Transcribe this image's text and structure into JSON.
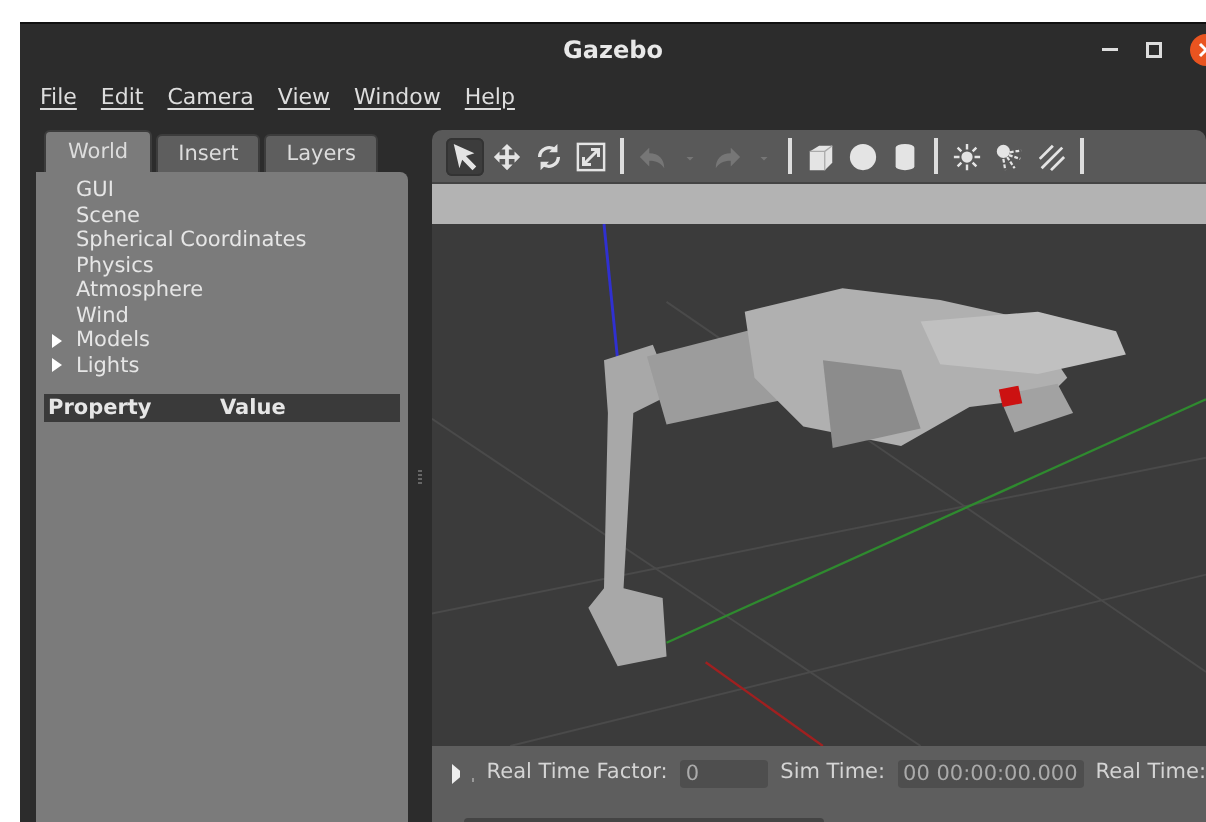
{
  "window": {
    "title": "Gazebo",
    "controls": [
      {
        "kind": "minimize"
      },
      {
        "kind": "maximize"
      },
      {
        "kind": "close"
      }
    ]
  },
  "menu": [
    "File",
    "Edit",
    "Camera",
    "View",
    "Window",
    "Help"
  ],
  "tabs": [
    {
      "label": "World",
      "selected": true
    },
    {
      "label": "Insert",
      "selected": false
    },
    {
      "label": "Layers",
      "selected": false
    }
  ],
  "tree": [
    {
      "label": "GUI",
      "kind": "leaf"
    },
    {
      "label": "Scene",
      "kind": "leaf"
    },
    {
      "label": "Spherical Coordinates",
      "kind": "leaf"
    },
    {
      "label": "Physics",
      "kind": "leaf"
    },
    {
      "label": "Atmosphere",
      "kind": "leaf"
    },
    {
      "label": "Wind",
      "kind": "leaf"
    },
    {
      "label": "Models",
      "kind": "group",
      "expanded": false
    },
    {
      "label": "Lights",
      "kind": "group",
      "expanded": false
    }
  ],
  "properties": {
    "columns": [
      "Property",
      "Value"
    ]
  },
  "toolbar": [
    {
      "tools": [
        {
          "kind": "select",
          "selected": true,
          "disabled": false
        },
        {
          "kind": "translate",
          "selected": false,
          "disabled": false
        },
        {
          "kind": "rotate",
          "selected": false,
          "disabled": false
        },
        {
          "kind": "scale",
          "selected": false,
          "disabled": false
        }
      ]
    },
    {
      "tools": [
        {
          "kind": "undo",
          "selected": false,
          "disabled": true
        },
        {
          "kind": "caret",
          "selected": false,
          "disabled": true
        },
        {
          "kind": "redo",
          "selected": false,
          "disabled": true
        },
        {
          "kind": "caret",
          "selected": false,
          "disabled": true
        }
      ]
    },
    {
      "tools": [
        {
          "kind": "box",
          "selected": false,
          "disabled": false
        },
        {
          "kind": "sphere",
          "selected": false,
          "disabled": false
        },
        {
          "kind": "cylinder",
          "selected": false,
          "disabled": false
        }
      ]
    },
    {
      "tools": [
        {
          "kind": "pointlight",
          "selected": false,
          "disabled": false
        },
        {
          "kind": "spotlight",
          "selected": false,
          "disabled": false
        },
        {
          "kind": "dirlight",
          "selected": false,
          "disabled": false
        }
      ]
    }
  ],
  "status_bar": {
    "real_time_factor_label": "Real Time Factor:",
    "real_time_factor": "0",
    "sim_time_label": "Sim Time:",
    "sim_time": "00 00:00:00.000",
    "real_time_label": "Real Time:"
  }
}
